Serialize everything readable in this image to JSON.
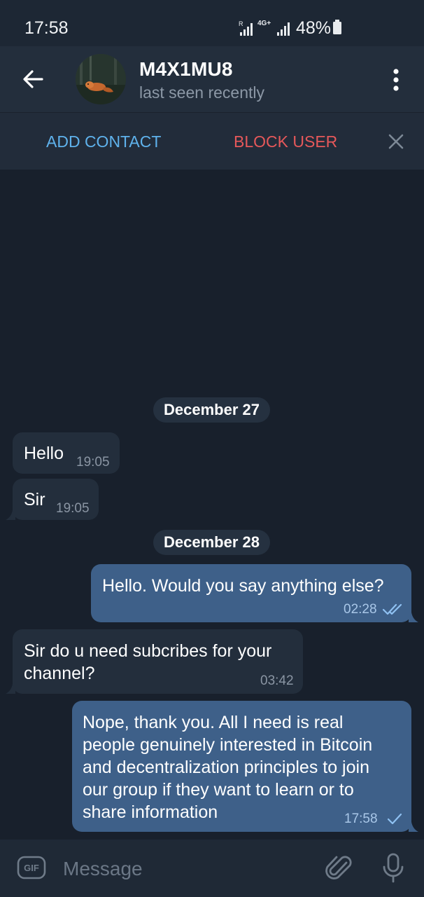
{
  "status_bar": {
    "time": "17:58",
    "network": "4G+",
    "battery": "48%"
  },
  "header": {
    "title": "M4X1MU8",
    "subtitle": "last seen recently"
  },
  "action_bar": {
    "add_contact": "ADD CONTACT",
    "block_user": "BLOCK USER"
  },
  "messages": [
    {
      "type": "date",
      "text": "December 27"
    },
    {
      "type": "in",
      "text": "Hello",
      "time": "19:05"
    },
    {
      "type": "in",
      "text": "Sir",
      "time": "19:05"
    },
    {
      "type": "date",
      "text": "December 28"
    },
    {
      "type": "out",
      "text": "Hello. Would you say anything else?",
      "time": "02:28",
      "status": "read"
    },
    {
      "type": "in",
      "lines": [
        "Sir do u need subcribes for your",
        "channel?"
      ],
      "time": "03:42"
    },
    {
      "type": "out",
      "lines": [
        "Nope, thank you. All I need is real",
        "people genuinely interested in Bitcoin",
        "and decentralization principles to join",
        "our group if they want to learn or to",
        "share information"
      ],
      "time": "17:58",
      "status": "sent"
    }
  ],
  "composer": {
    "gif_label": "GIF",
    "placeholder": "Message"
  },
  "colors": {
    "background": "#18202c",
    "header": "#232e3c",
    "incoming_bubble": "#232e3c",
    "outgoing_bubble": "#3e6089",
    "accent_blue": "#5fb2ec",
    "danger_red": "#e6585a"
  }
}
